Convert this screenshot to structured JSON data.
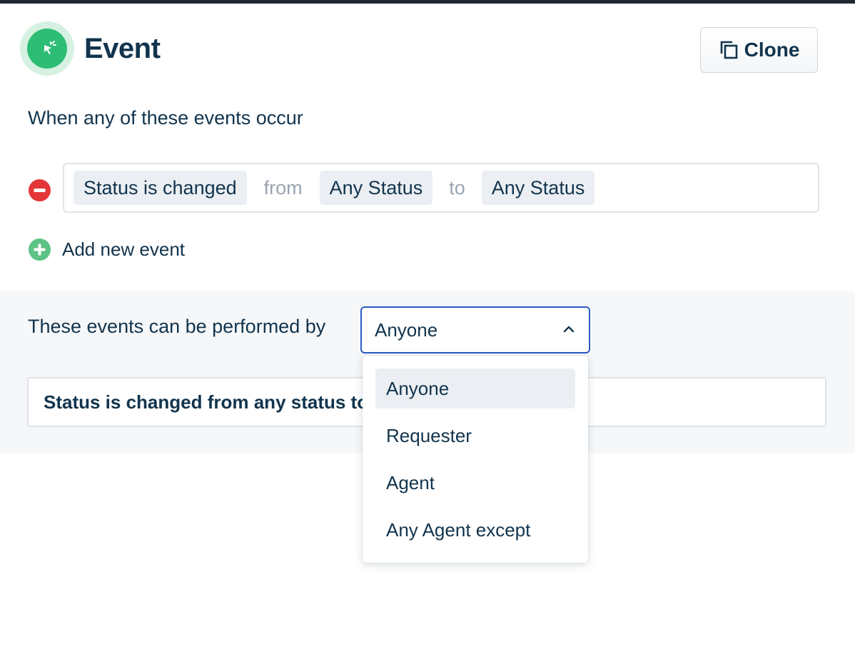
{
  "header": {
    "title": "Event",
    "clone_label": "Clone",
    "icon": "cursor-click-icon"
  },
  "subtitle": "When any of these events occur",
  "event_row": {
    "trigger": "Status is changed",
    "from_label": "from",
    "from_value": "Any Status",
    "to_label": "to",
    "to_value": "Any Status"
  },
  "add_event_label": "Add new event",
  "performed_by": {
    "label": "These events can be performed by",
    "selected": "Anyone",
    "options": [
      "Anyone",
      "Requester",
      "Agent",
      "Any Agent except"
    ]
  },
  "summary": "Status is changed from any status to",
  "colors": {
    "accent_green": "#2ebd75",
    "remove_red": "#e43538",
    "focus_blue": "#2c5cc5",
    "text": "#12344d"
  }
}
